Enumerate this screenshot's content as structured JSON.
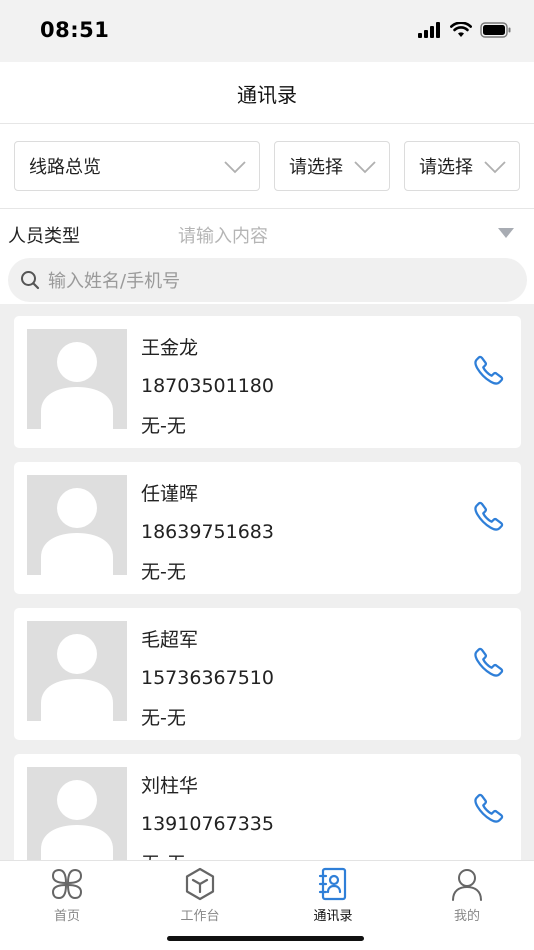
{
  "status_bar": {
    "time": "08:51"
  },
  "header": {
    "title": "通讯录"
  },
  "filters": {
    "line_select": "线路总览",
    "select_a": "请选择",
    "select_b": "请选择"
  },
  "person_type": {
    "label": "人员类型",
    "placeholder": "请输入内容"
  },
  "search": {
    "placeholder": "输入姓名/手机号"
  },
  "contacts": [
    {
      "name": "王金龙",
      "phone": "18703501180",
      "dept": "无-无"
    },
    {
      "name": "任谨晖",
      "phone": "18639751683",
      "dept": "无-无"
    },
    {
      "name": "毛超军",
      "phone": "15736367510",
      "dept": "无-无"
    },
    {
      "name": "刘柱华",
      "phone": "13910767335",
      "dept": "无-无"
    }
  ],
  "tabbar": [
    {
      "label": "首页",
      "icon": "home-grid-icon"
    },
    {
      "label": "工作台",
      "icon": "cube-icon"
    },
    {
      "label": "通讯录",
      "icon": "contacts-book-icon",
      "active": true
    },
    {
      "label": "我的",
      "icon": "person-icon"
    }
  ],
  "colors": {
    "accent": "#2f7fd8",
    "avatar_bg": "#dedede",
    "list_bg": "#efefef"
  }
}
